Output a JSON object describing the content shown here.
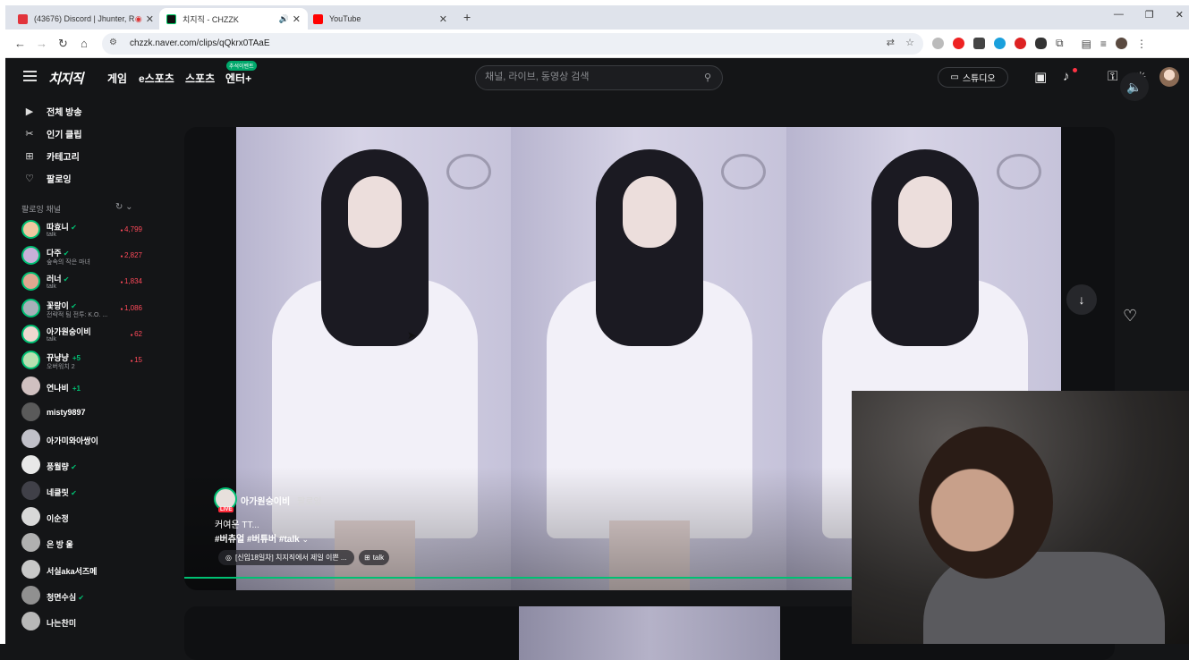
{
  "browser": {
    "tabs": [
      {
        "title": "(43676) Discord | Jhunter, R",
        "color": "#5865f2",
        "active": false
      },
      {
        "title": "치지직 - CHZZK",
        "color": "#111111",
        "active": true
      },
      {
        "title": "YouTube",
        "color": "#ff0000",
        "active": false
      }
    ],
    "new_tab": "+",
    "url": "chzzk.naver.com/clips/qQkrx0TAaE"
  },
  "header": {
    "logo": "치지직",
    "nav": [
      "게임",
      "e스포츠",
      "스포츠",
      "엔터+"
    ],
    "enter_badge": "추석이벤트",
    "search_placeholder": "채널, 라이브, 동영상 검색",
    "studio_label": "스튜디오"
  },
  "sidebar": {
    "menu": [
      {
        "label": "전체 방송",
        "icon": "tv-icon"
      },
      {
        "label": "인기 클립",
        "icon": "scissors-icon"
      },
      {
        "label": "카테고리",
        "icon": "grid-icon"
      },
      {
        "label": "팔로잉",
        "icon": "heart-icon"
      }
    ],
    "following_heading": "팔로잉 채널",
    "channels": [
      {
        "name": "따효니",
        "sub": "talk",
        "viewers": "4,799",
        "verified": true,
        "extra": ""
      },
      {
        "name": "다주",
        "sub": "숲속의 작은 마녀",
        "viewers": "2,827",
        "verified": true,
        "extra": ""
      },
      {
        "name": "러너",
        "sub": "talk",
        "viewers": "1,834",
        "verified": true,
        "extra": ""
      },
      {
        "name": "꽃랑이",
        "sub": "전략적 팀 전투: K.O. ...",
        "viewers": "1,086",
        "verified": true,
        "extra": ""
      },
      {
        "name": "아가원숭이비",
        "sub": "talk",
        "viewers": "62",
        "verified": false,
        "extra": ""
      },
      {
        "name": "뀨냥냥",
        "sub": "오버워치 2",
        "viewers": "15",
        "verified": false,
        "extra": "+5"
      },
      {
        "name": "연나비",
        "sub": "",
        "viewers": "",
        "verified": false,
        "extra": "+1"
      },
      {
        "name": "misty9897",
        "sub": "",
        "viewers": "",
        "verified": false,
        "extra": ""
      },
      {
        "name": "아가미와아쌍이",
        "sub": "",
        "viewers": "",
        "verified": false,
        "extra": ""
      },
      {
        "name": "풍월량",
        "sub": "",
        "viewers": "",
        "verified": true,
        "extra": ""
      },
      {
        "name": "네클릿",
        "sub": "",
        "viewers": "",
        "verified": true,
        "extra": ""
      },
      {
        "name": "이순정",
        "sub": "",
        "viewers": "",
        "verified": false,
        "extra": ""
      },
      {
        "name": "은 방 울",
        "sub": "",
        "viewers": "",
        "verified": false,
        "extra": ""
      },
      {
        "name": "서실aka서즈메",
        "sub": "",
        "viewers": "",
        "verified": false,
        "extra": ""
      },
      {
        "name": "청면수심",
        "sub": "",
        "viewers": "",
        "verified": true,
        "extra": ""
      },
      {
        "name": "나는찬미",
        "sub": "",
        "viewers": "",
        "verified": false,
        "extra": ""
      }
    ]
  },
  "clip": {
    "channel_name": "아가원숭이비",
    "live_badge": "LIVE",
    "follow_label": "팔로잉",
    "title": "커여운 TT...",
    "tags": "#버츄얼 #버튜버 #talk",
    "linked_clip": "[신입18일차] 치지직에서 제일 이쁜 ...",
    "category_tag": "talk",
    "progress": 0.72
  }
}
